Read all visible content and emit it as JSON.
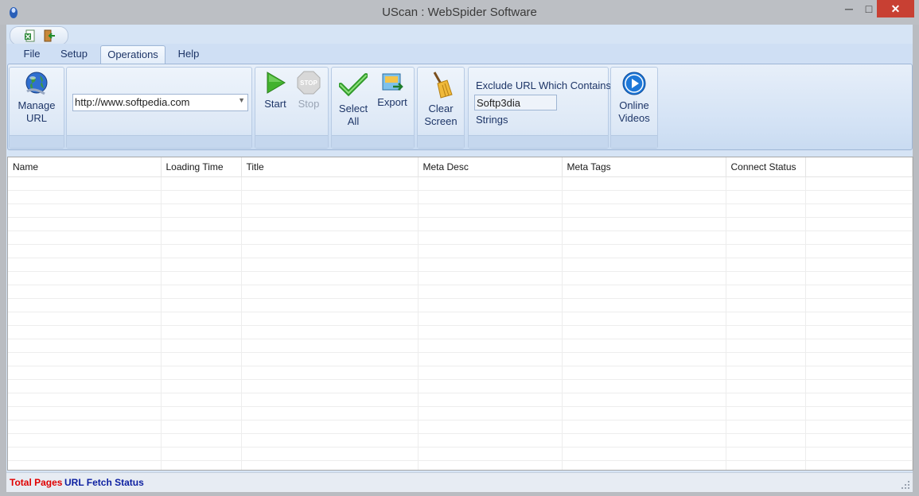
{
  "window": {
    "title": "UScan : WebSpider Software",
    "minimize": "─",
    "maximize": "□",
    "close": "✕"
  },
  "quick_access": [
    {
      "name": "excel-export-icon"
    },
    {
      "name": "exit-icon"
    }
  ],
  "tabs": [
    {
      "label": "File",
      "active": false
    },
    {
      "label": "Setup",
      "active": false
    },
    {
      "label": "Operations",
      "active": true
    },
    {
      "label": "Help",
      "active": false
    }
  ],
  "ribbon": {
    "manage_url": {
      "line1": "Manage",
      "line2": "URL",
      "icon": "globe-icon"
    },
    "url_select": {
      "value": "http://www.softpedia.com"
    },
    "start": {
      "label": "Start",
      "icon": "play-icon"
    },
    "stop": {
      "label": "Stop",
      "icon": "stop-icon",
      "disabled": true
    },
    "select_all": {
      "line1": "Select",
      "line2": "All",
      "icon": "checkmark-icon"
    },
    "export": {
      "label": "Export",
      "icon": "export-icon"
    },
    "clear_screen": {
      "line1": "Clear",
      "line2": "Screen",
      "icon": "broom-icon"
    },
    "exclude": {
      "label": "Exclude URL Which Contains",
      "value": "Softp3dia",
      "strings_label": "Strings"
    },
    "online_videos": {
      "line1": "Online",
      "line2": "Videos",
      "icon": "video-play-icon"
    }
  },
  "grid": {
    "columns": [
      "Name",
      "Loading Time",
      "Title",
      "Meta Desc",
      "Meta Tags",
      "Connect Status",
      ""
    ],
    "rows": []
  },
  "status": {
    "total_pages": "Total Pages",
    "url_fetch_status": "URL Fetch Status"
  },
  "colors": {
    "accent": "#d6e4f5",
    "total_pages": "#e00000",
    "fetch_status": "#0c1fa0",
    "close_button": "#c84033"
  }
}
